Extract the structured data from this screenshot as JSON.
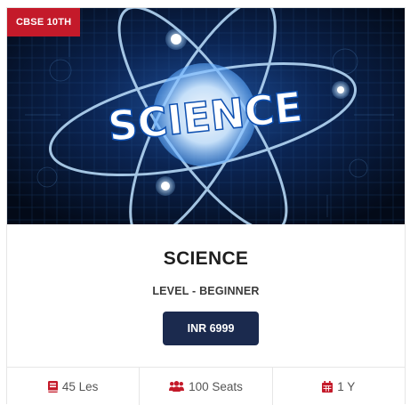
{
  "course_card": {
    "badge": "CBSE 10TH",
    "banner_text": "SCIENCE",
    "title": "SCIENCE",
    "level": "LEVEL - BEGINNER",
    "price_button": "INR 6999",
    "stats": {
      "lessons": {
        "icon": "book-icon",
        "text": "45 Les"
      },
      "seats": {
        "icon": "users-icon",
        "text": "100 Seats"
      },
      "duration": {
        "icon": "calendar-icon",
        "text": "1 Y"
      }
    }
  },
  "colors": {
    "badge": "#c41a2a",
    "button": "#1b2a4e",
    "icon_accent": "#c41a2a",
    "hero_bg": "#050d1e",
    "hero_glow": "#3aa0ff"
  }
}
